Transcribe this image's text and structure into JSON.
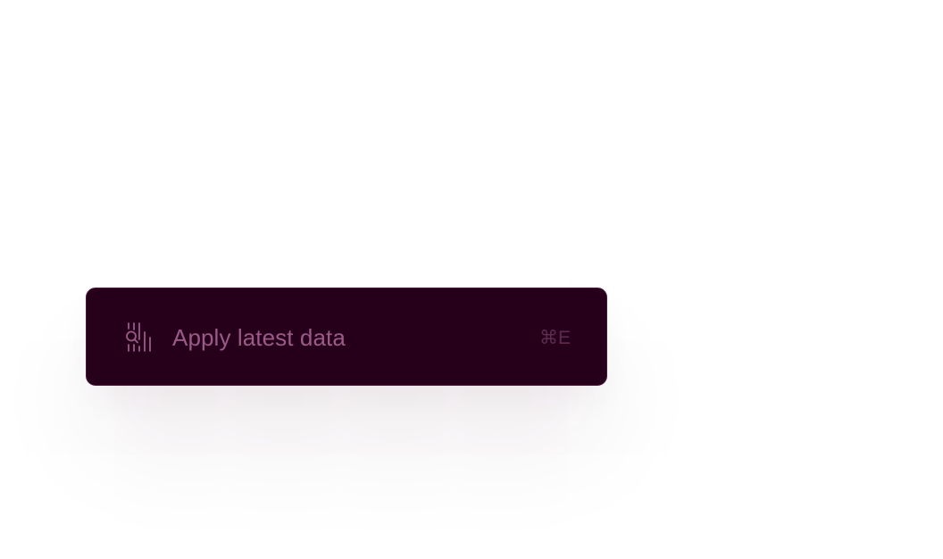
{
  "menu": {
    "item": {
      "icon": "apply-data-icon",
      "label": "Apply latest data",
      "shortcut": "⌘E"
    }
  },
  "colors": {
    "background": "#26001a",
    "border": "#4b1a3c",
    "label": "#9b5a89",
    "shortcut": "#5e2b50"
  }
}
